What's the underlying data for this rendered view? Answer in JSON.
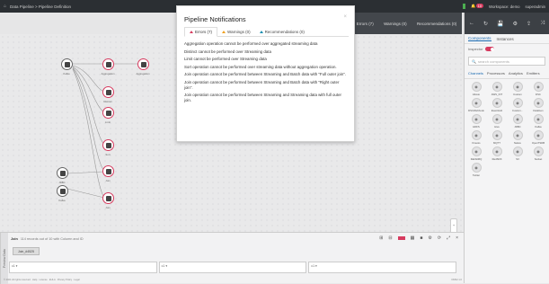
{
  "topbar": {
    "home": "⌂",
    "breadcrumb": "Data Pipeline > Pipeline Definition",
    "notif_count": "10",
    "workspace": "Workspace: demo",
    "user": "superadmin"
  },
  "issues_bar": {
    "errors": "Errors (7)",
    "warnings": "Warnings (0)",
    "recommendations": "Recommendations (0)"
  },
  "modal": {
    "title": "Pipeline Notifications",
    "close": "×",
    "tabs": [
      {
        "label": "Errors (7)",
        "kind": "error"
      },
      {
        "label": "Warnings (0)",
        "kind": "warn"
      },
      {
        "label": "Recommendations (0)",
        "kind": "rec"
      }
    ],
    "messages": [
      "Aggregation operation cannot be performed over aggregated streaming data",
      "Distinct cannot be performed over Streaming data",
      "Limit cannot be performed over Streaming data",
      "Sort operation cannot be performed over streaming data without aggregation operation.",
      "Join operation cannot be performed between Streaming and Batch data with \"Full outer join\".",
      "Join operation cannot be performed between Streaming and Batch data with \"Right outer join\".",
      "Join operation cannot be performed between Streaming and Streaming data with full outer join."
    ]
  },
  "canvas": {
    "nodes": {
      "n1": "Kafka",
      "n2": "Aggregation",
      "n3": "Aggregation",
      "n4": "Distinct",
      "n5": "Limit",
      "n6": "Sort",
      "n7": "Join",
      "n8": "JDBC",
      "n9": "Join",
      "n10": "Kafka",
      "n11": "Join"
    }
  },
  "right_panel": {
    "tabs": [
      "Components",
      "Instances"
    ],
    "inspector_label": "Inspector",
    "search_placeholder": "search components",
    "categories": [
      "Channels",
      "Processors",
      "Analytics",
      "Emitters"
    ],
    "components": [
      "Alluxio",
      "AWS_IOT",
      "Custom",
      "DSC",
      "DSCWebhook",
      "EventHub",
      "Custom...",
      "DataGen",
      "HDFS",
      "Hive",
      "JDBC",
      "Kafka",
      "Kinesis",
      "MQTT",
      "Native",
      "OpenTSDB",
      "RabbitMQ",
      "RedShift",
      "S3",
      "Socket",
      "Twitter"
    ]
  },
  "bottom": {
    "title": "Join",
    "subtitle": "114 records out of 10 with Column and ID",
    "tab": "Join_#4525",
    "preview_label": "Preview Data",
    "columns": [
      "c1 ▾",
      "c1 ▾",
      "c1 ▾"
    ]
  },
  "footer": {
    "copyright": "© 2021 All rights reserved · Help · License · EULA · Privacy Policy · Legal",
    "version": "DMS2.1.0"
  }
}
